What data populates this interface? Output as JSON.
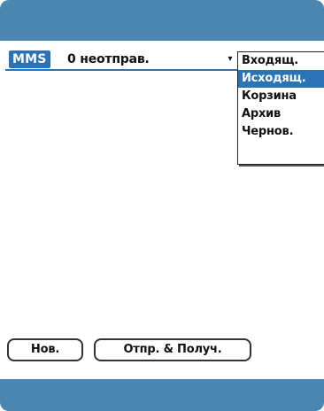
{
  "header": {
    "app_title": "MMS",
    "status_text": "0 неотправ."
  },
  "folder_menu": {
    "trigger_glyph": "▾",
    "selected_index": 1,
    "items": [
      {
        "label": "Входящ."
      },
      {
        "label": "Исходящ."
      },
      {
        "label": "Корзина"
      },
      {
        "label": "Архив"
      },
      {
        "label": "Чернов."
      }
    ]
  },
  "buttons": {
    "new_label": "Нов.",
    "send_receive_label": "Отпр. & Получ."
  },
  "colors": {
    "accent": "#2c73b5",
    "bezel": "#4a86b0"
  }
}
